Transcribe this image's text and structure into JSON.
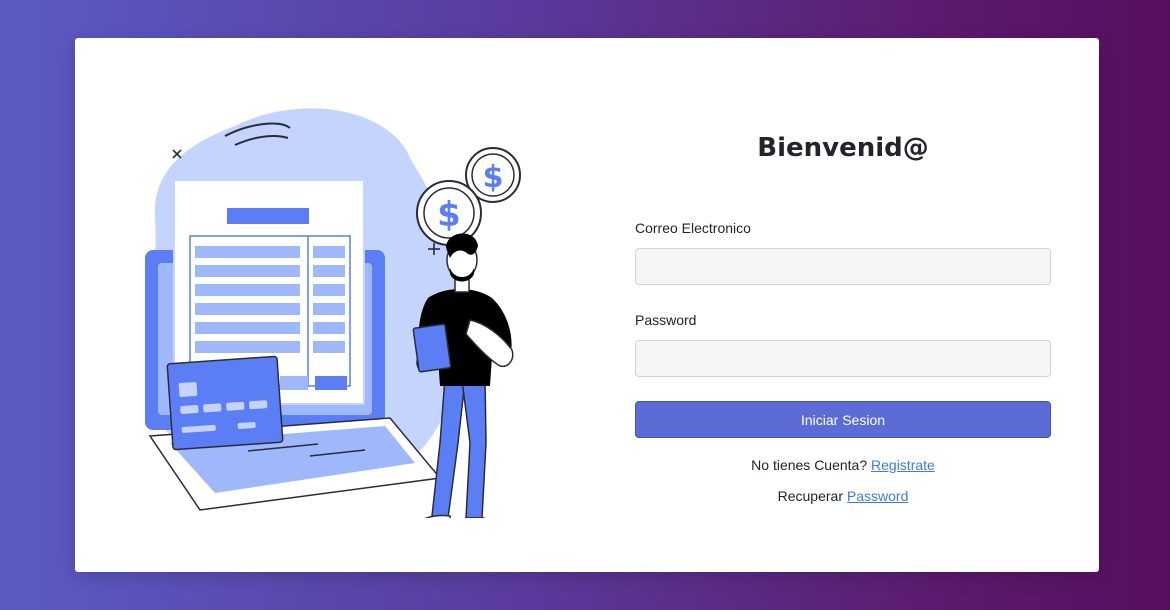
{
  "login": {
    "title": "Bienvenid@",
    "email_label": "Correo Electronico",
    "email_value": "",
    "password_label": "Password",
    "password_value": "",
    "submit_label": "Iniciar Sesion",
    "register_prompt": "No tienes Cuenta? ",
    "register_link": "Registrate",
    "recover_prompt": "Recuperar ",
    "recover_link": "Password"
  },
  "illustration": {
    "coin_symbol": "$"
  },
  "colors": {
    "accent": "#5c6bd5",
    "link": "#3d7be0",
    "illustration_blue": "#5b7ef5",
    "illustration_light": "#c4d4fd"
  }
}
